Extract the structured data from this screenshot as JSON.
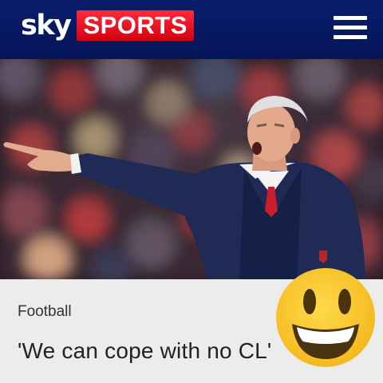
{
  "header": {
    "logo_sky": "sky",
    "logo_sports": "SPORTS",
    "brand_color": "#0a1d6b",
    "accent_color": "#e10a1a",
    "menu_icon": "hamburger-menu-icon"
  },
  "article": {
    "category": "Football",
    "headline": "'We can cope with no CL'"
  },
  "overlay": {
    "emoji_icon": "grinning-face-icon"
  }
}
